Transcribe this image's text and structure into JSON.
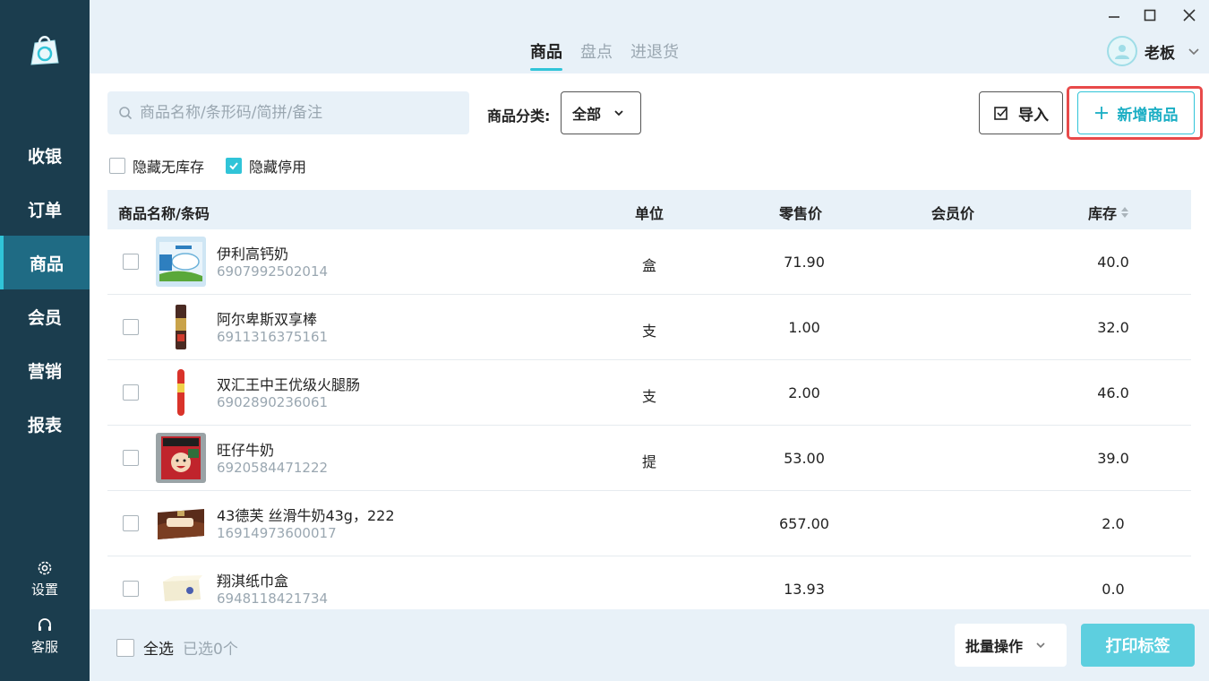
{
  "sidebar": {
    "items": [
      {
        "label": "收银",
        "icon": "none"
      },
      {
        "label": "订单",
        "icon": "none"
      },
      {
        "label": "商品",
        "icon": "none",
        "active": true
      },
      {
        "label": "会员",
        "icon": "none"
      },
      {
        "label": "营销",
        "icon": "none"
      },
      {
        "label": "报表",
        "icon": "none"
      }
    ],
    "settings_label": "设置",
    "support_label": "客服"
  },
  "header": {
    "tabs": [
      {
        "label": "商品",
        "active": true
      },
      {
        "label": "盘点",
        "active": false
      },
      {
        "label": "进退货",
        "active": false
      }
    ],
    "user_name": "老板"
  },
  "toolbar": {
    "search_placeholder": "商品名称/条形码/简拼/备注",
    "category_label": "商品分类:",
    "category_value": "全部",
    "import_label": "导入",
    "add_label": "新增商品"
  },
  "filters": {
    "hide_no_stock": {
      "label": "隐藏无库存",
      "checked": false
    },
    "hide_disabled": {
      "label": "隐藏停用",
      "checked": true
    }
  },
  "table": {
    "columns": {
      "name": "商品名称/条码",
      "unit": "单位",
      "price": "零售价",
      "member_price": "会员价",
      "stock": "库存"
    },
    "rows": [
      {
        "name": "伊利高钙奶",
        "code": "6907992502014",
        "unit": "盒",
        "price": "71.90",
        "member_price": "",
        "stock": "40.0"
      },
      {
        "name": "阿尔卑斯双享棒",
        "code": "6911316375161",
        "unit": "支",
        "price": "1.00",
        "member_price": "",
        "stock": "32.0"
      },
      {
        "name": "双汇王中王优级火腿肠",
        "code": "6902890236061",
        "unit": "支",
        "price": "2.00",
        "member_price": "",
        "stock": "46.0"
      },
      {
        "name": "旺仔牛奶",
        "code": "6920584471222",
        "unit": "提",
        "price": "53.00",
        "member_price": "",
        "stock": "39.0"
      },
      {
        "name": "43德芙 丝滑牛奶43g，222",
        "code": "16914973600017",
        "unit": "",
        "price": "657.00",
        "member_price": "",
        "stock": "2.0"
      },
      {
        "name": "翔淇纸巾盒",
        "code": "6948118421734",
        "unit": "",
        "price": "13.93",
        "member_price": "",
        "stock": "0.0"
      }
    ]
  },
  "footer": {
    "select_all_label": "全选",
    "selected_count": "已选0个",
    "batch_label": "批量操作",
    "print_label": "打印标签"
  },
  "colors": {
    "sidebar": "#1b3d4e",
    "sidebar_active": "#1f6b84",
    "accent": "#30c4d8",
    "highlight_border": "#e84a4a",
    "background": "#e8f1f8"
  }
}
